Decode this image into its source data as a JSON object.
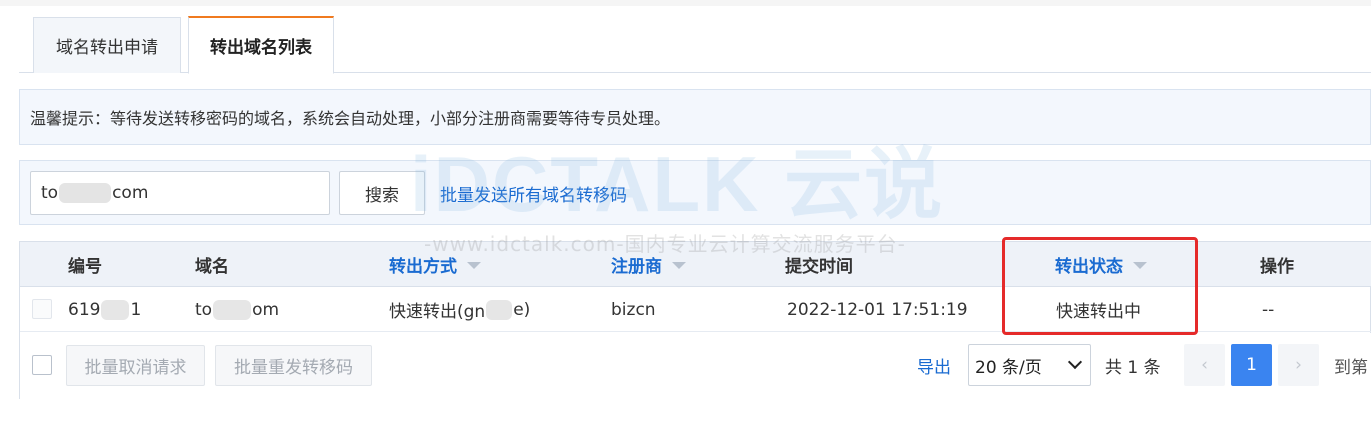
{
  "tabs": [
    {
      "label": "域名转出申请",
      "active": false
    },
    {
      "label": "转出域名列表",
      "active": true
    }
  ],
  "notice": {
    "text": "温馨提示：等待发送转移密码的域名，系统会自动处理，小部分注册商需要等待专员处理。"
  },
  "search": {
    "value_prefix": "to",
    "value_suffix": "com",
    "button_label": "搜索",
    "batch_send_label": "批量发送所有域名转移码"
  },
  "table": {
    "headers": {
      "id": "编号",
      "domain": "域名",
      "method": "转出方式",
      "registrar": "注册商",
      "submitted": "提交时间",
      "status": "转出状态",
      "actions": "操作"
    },
    "rows": [
      {
        "id_prefix": "619",
        "id_suffix": "1",
        "domain_prefix": "to",
        "domain_suffix": "om",
        "method_prefix": "快速转出(gn",
        "method_suffix": "e)",
        "registrar": "bizcn",
        "submitted": "2022-12-01 17:51:19",
        "status": "快速转出中",
        "actions": "--"
      }
    ]
  },
  "footer": {
    "cancel_label": "批量取消请求",
    "resend_label": "批量重发转移码",
    "export_label": "导出",
    "page_size": "20 条/页",
    "total": "共 1 条",
    "prev": "‹",
    "page": "1",
    "next": "›",
    "goto_label": "到第"
  },
  "watermark": {
    "brand": "iDCTALK 云说",
    "sub": "-www.idctalk.com-国内专业云计算交流服务平台-"
  },
  "colors": {
    "accent": "#1a6bd1",
    "tab_active_border": "#f07a1f",
    "highlight": "#e52a2a",
    "page_active": "#3a84f0"
  }
}
